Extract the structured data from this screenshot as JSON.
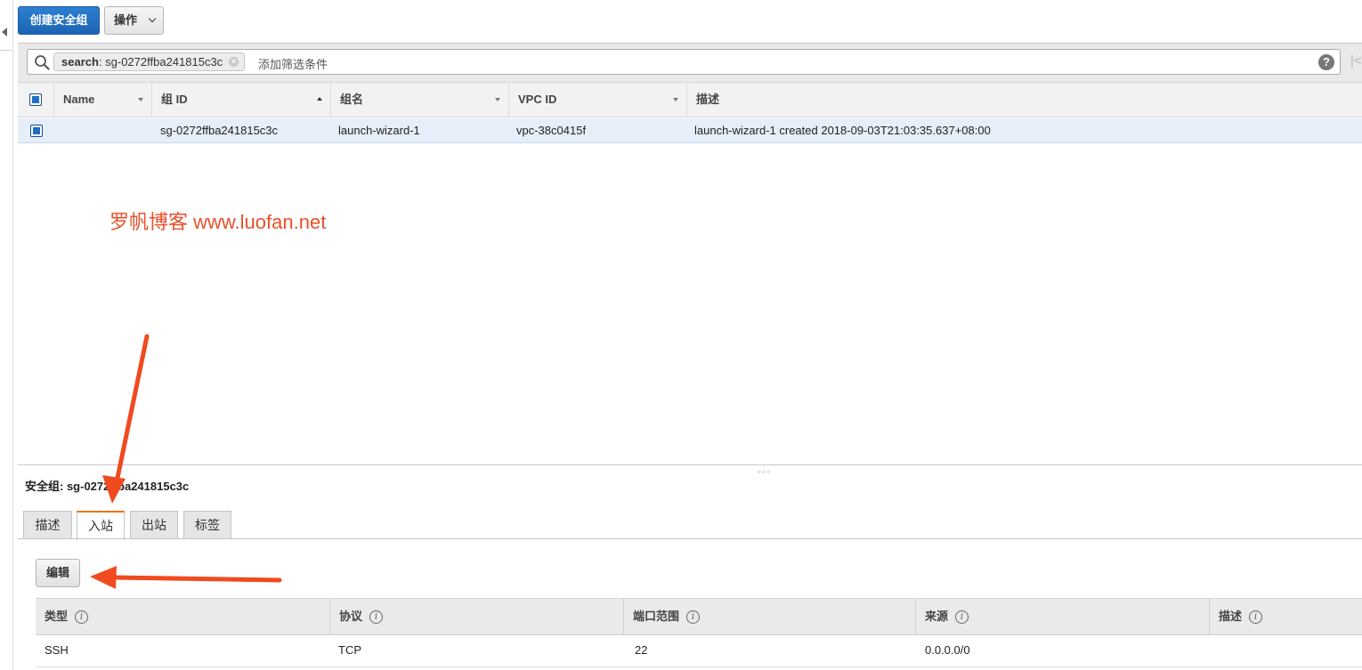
{
  "toolbar": {
    "create_label": "创建安全组",
    "actions_label": "操作"
  },
  "filter": {
    "token_key": "search",
    "token_value": ": sg-0272ffba241815c3c",
    "placeholder": "添加筛选条件",
    "help": "?"
  },
  "table": {
    "columns": [
      "Name",
      "组 ID",
      "组名",
      "VPC ID",
      "描述"
    ],
    "sorted_column": "组 ID",
    "rows": [
      {
        "name": "",
        "group_id": "sg-0272ffba241815c3c",
        "group_name": "launch-wizard-1",
        "vpc_id": "vpc-38c0415f",
        "description": "launch-wizard-1 created 2018-09-03T21:03:35.637+08:00"
      }
    ]
  },
  "watermark": "罗帆博客  www.luofan.net",
  "details": {
    "title": "安全组: sg-0272ffba241815c3c",
    "tabs": [
      "描述",
      "入站",
      "出站",
      "标签"
    ],
    "active_tab": "入站",
    "edit_label": "编辑",
    "rule_columns": [
      "类型",
      "协议",
      "端口范围",
      "来源",
      "描述"
    ],
    "rules": [
      {
        "type": "SSH",
        "protocol": "TCP",
        "port_range": "22",
        "source": "0.0.0.0/0",
        "description": ""
      }
    ]
  },
  "colors": {
    "primary_button": "#1c64b4",
    "selected_row": "#e6eff9",
    "active_tab_accent": "#ec7211",
    "annotation_arrow": "#f04a1e",
    "watermark": "#e8502a"
  }
}
